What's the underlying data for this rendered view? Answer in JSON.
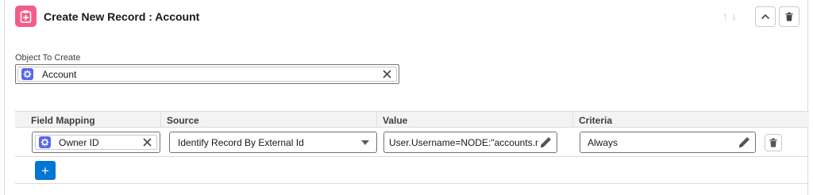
{
  "header": {
    "title": "Create New Record : Account",
    "icon": "clipboard-add-icon",
    "icon_color": "#f45c87",
    "arrows": "↑↓"
  },
  "object_to_create": {
    "label": "Object To Create",
    "value": "Account",
    "icon": "gear-icon"
  },
  "table": {
    "columns": [
      "Field Mapping",
      "Source",
      "Value",
      "Criteria"
    ],
    "rows": [
      {
        "field_mapping": "Owner ID",
        "source": "Identify Record By External Id",
        "value": "User.Username=NODE:\"accounts.name",
        "criteria": "Always"
      }
    ]
  },
  "add_button_label": "+",
  "accent_color": "#0176d3"
}
